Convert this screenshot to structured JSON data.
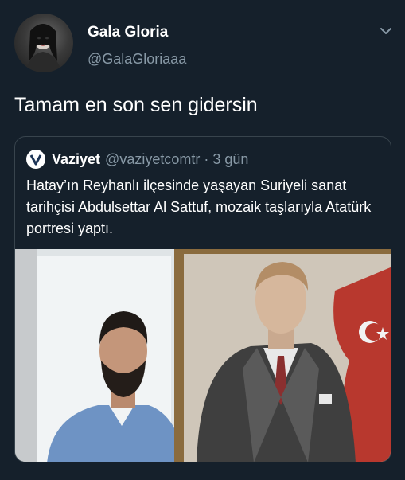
{
  "author": {
    "name": "Gala Gloria",
    "handle": "@GalaGloriaaa"
  },
  "tweet": {
    "text": "Tamam en son sen gidersin"
  },
  "quoted_tweet": {
    "account_name": "Vaziyet",
    "handle": "@vaziyetcomtr",
    "separator": "·",
    "time": "3 gün",
    "text": "Hatay’ın Reyhanlı ilçesinde yaşayan Suriyeli sanat tarihçisi Abdulsettar Al Sattuf, mozaik taşlarıyla Atatürk portresi yaptı."
  },
  "icons": {
    "more": "chevron-down-icon",
    "source_logo": "vaziyet-logo-icon"
  },
  "colors": {
    "background": "#15202b",
    "secondary_text": "#8899a6",
    "border": "#38444d"
  }
}
